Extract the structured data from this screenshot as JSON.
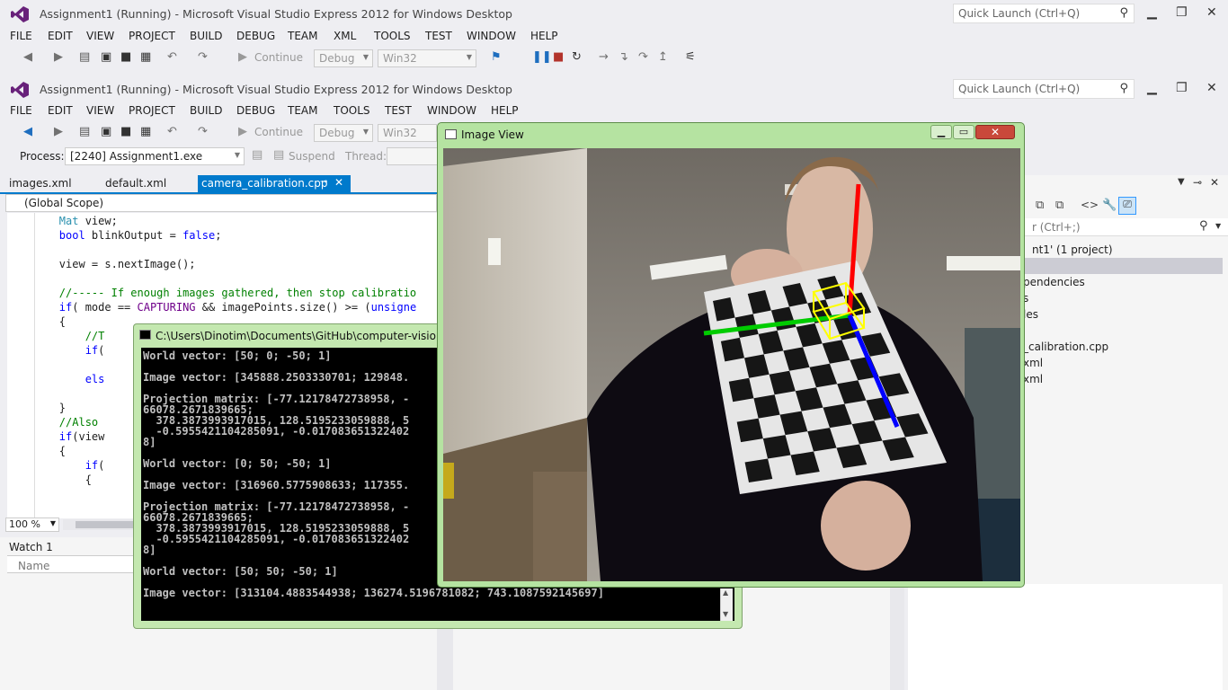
{
  "app": {
    "title": "Assignment1 (Running) - Microsoft Visual Studio Express 2012 for Windows Desktop",
    "quick_launch_placeholder": "Quick Launch (Ctrl+Q)"
  },
  "menu_back": [
    "FILE",
    "EDIT",
    "VIEW",
    "PROJECT",
    "BUILD",
    "DEBUG",
    "TEAM",
    "XML",
    "TOOLS",
    "TEST",
    "WINDOW",
    "HELP"
  ],
  "menu_front": [
    "FILE",
    "EDIT",
    "VIEW",
    "PROJECT",
    "BUILD",
    "DEBUG",
    "TEAM",
    "TOOLS",
    "TEST",
    "WINDOW",
    "HELP"
  ],
  "toolbar": {
    "continue_label": "Continue",
    "config": "Debug",
    "platform": "Win32",
    "process_label": "Process:",
    "process_value": "[2240] Assignment1.exe",
    "suspend_label": "Suspend",
    "thread_label": "Thread:"
  },
  "tabs": [
    {
      "label": "images.xml"
    },
    {
      "label": "default.xml"
    },
    {
      "label": "camera_calibration.cpp",
      "pin": "⊸",
      "close": "✕"
    }
  ],
  "scope": "(Global Scope)",
  "zoom": "100 %",
  "watch": {
    "title": "Watch 1",
    "column_name": "Name"
  },
  "code_lines": [
    {
      "parts": [
        {
          "c": "ty",
          "t": "        Mat"
        },
        {
          "c": "",
          "t": " view;"
        }
      ]
    },
    {
      "parts": [
        {
          "c": "kw",
          "t": "        bool"
        },
        {
          "c": "",
          "t": " blinkOutput = "
        },
        {
          "c": "kw",
          "t": "false"
        },
        {
          "c": "",
          "t": ";"
        }
      ]
    },
    {
      "parts": [
        {
          "c": "",
          "t": ""
        }
      ]
    },
    {
      "parts": [
        {
          "c": "",
          "t": "        view = s.nextImage();"
        }
      ]
    },
    {
      "parts": [
        {
          "c": "",
          "t": ""
        }
      ]
    },
    {
      "parts": [
        {
          "c": "cm",
          "t": "        //----- If enough images gathered, then stop calibratio"
        }
      ]
    },
    {
      "parts": [
        {
          "c": "kw",
          "t": "        if"
        },
        {
          "c": "",
          "t": "( mode == "
        },
        {
          "c": "pp",
          "t": "CAPTURING"
        },
        {
          "c": "",
          "t": " && imagePoints.size() >= ("
        },
        {
          "c": "kw",
          "t": "unsigne"
        }
      ]
    },
    {
      "parts": [
        {
          "c": "",
          "t": "        {"
        }
      ]
    },
    {
      "parts": [
        {
          "c": "cm",
          "t": "            //T"
        }
      ]
    },
    {
      "parts": [
        {
          "c": "kw",
          "t": "            if"
        },
        {
          "c": "",
          "t": "("
        }
      ]
    },
    {
      "parts": [
        {
          "c": "",
          "t": ""
        }
      ]
    },
    {
      "parts": [
        {
          "c": "kw",
          "t": "            els"
        }
      ]
    },
    {
      "parts": [
        {
          "c": "",
          "t": ""
        }
      ]
    },
    {
      "parts": [
        {
          "c": "",
          "t": "        }"
        }
      ]
    },
    {
      "parts": [
        {
          "c": "cm",
          "t": "        //Also"
        }
      ]
    },
    {
      "parts": [
        {
          "c": "kw",
          "t": "        if"
        },
        {
          "c": "",
          "t": "(view"
        }
      ]
    },
    {
      "parts": [
        {
          "c": "",
          "t": "        {"
        }
      ]
    },
    {
      "parts": [
        {
          "c": "kw",
          "t": "            if"
        },
        {
          "c": "",
          "t": "("
        }
      ]
    },
    {
      "parts": [
        {
          "c": "",
          "t": "            {"
        }
      ]
    }
  ],
  "console": {
    "title": "C:\\Users\\Dinotim\\Documents\\GitHub\\computer-vision\\A",
    "lines": [
      "World vector: [50; 0; -50; 1]",
      "",
      "Image vector: [345888.2503330701; 129848.",
      "",
      "Projection matrix: [-77.12178472738958, -",
      "66078.2671839665;",
      "  378.3873993917015, 128.5195233059888, 5",
      "  -0.5955421104285091, -0.017083651322402",
      "8]",
      "",
      "World vector: [0; 50; -50; 1]",
      "",
      "Image vector: [316960.5775908633; 117355.",
      "",
      "Projection matrix: [-77.12178472738958, -",
      "66078.2671839665;",
      "  378.3873993917015, 128.5195233059888, 5",
      "  -0.5955421104285091, -0.017083651322402",
      "8]",
      "",
      "World vector: [50; 50; -50; 1]",
      "",
      "Image vector: [313104.4883544938; 136274.5196781082; 743.1087592145697]"
    ]
  },
  "image_view": {
    "title": "Image View"
  },
  "solution": {
    "search_placeholder": "r (Ctrl+;)",
    "items": [
      "nt1' (1 project)",
      "pendencies",
      "s",
      "les",
      "",
      "_calibration.cpp",
      "xml",
      "xml"
    ]
  },
  "colors": {
    "accent": "#007acc",
    "axis_x": "#ff0000",
    "axis_y": "#00d000",
    "axis_z": "#0000ff",
    "cube": "#ffff00"
  }
}
